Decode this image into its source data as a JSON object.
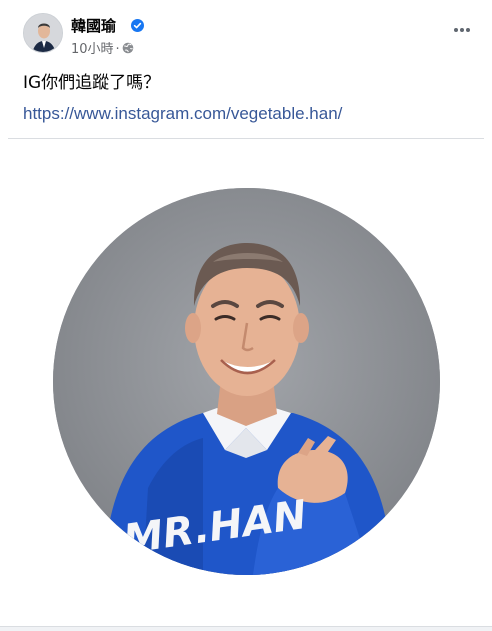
{
  "post": {
    "author": "韓國瑜",
    "verified": true,
    "timestamp": "10小時",
    "separator": "·",
    "privacy_icon": "globe-icon",
    "more_icon": "more-horizontal-icon",
    "text": "IG你們追蹤了嗎？",
    "link": "https://www.instagram.com/vegetable.han/",
    "image_overlay_text": "MR.HAN"
  },
  "colors": {
    "accent_blue": "#1877f2",
    "link": "#385898",
    "secondary_text": "#65676b",
    "photo_background": "#93969b",
    "sweater_blue": "#1f56c9"
  }
}
